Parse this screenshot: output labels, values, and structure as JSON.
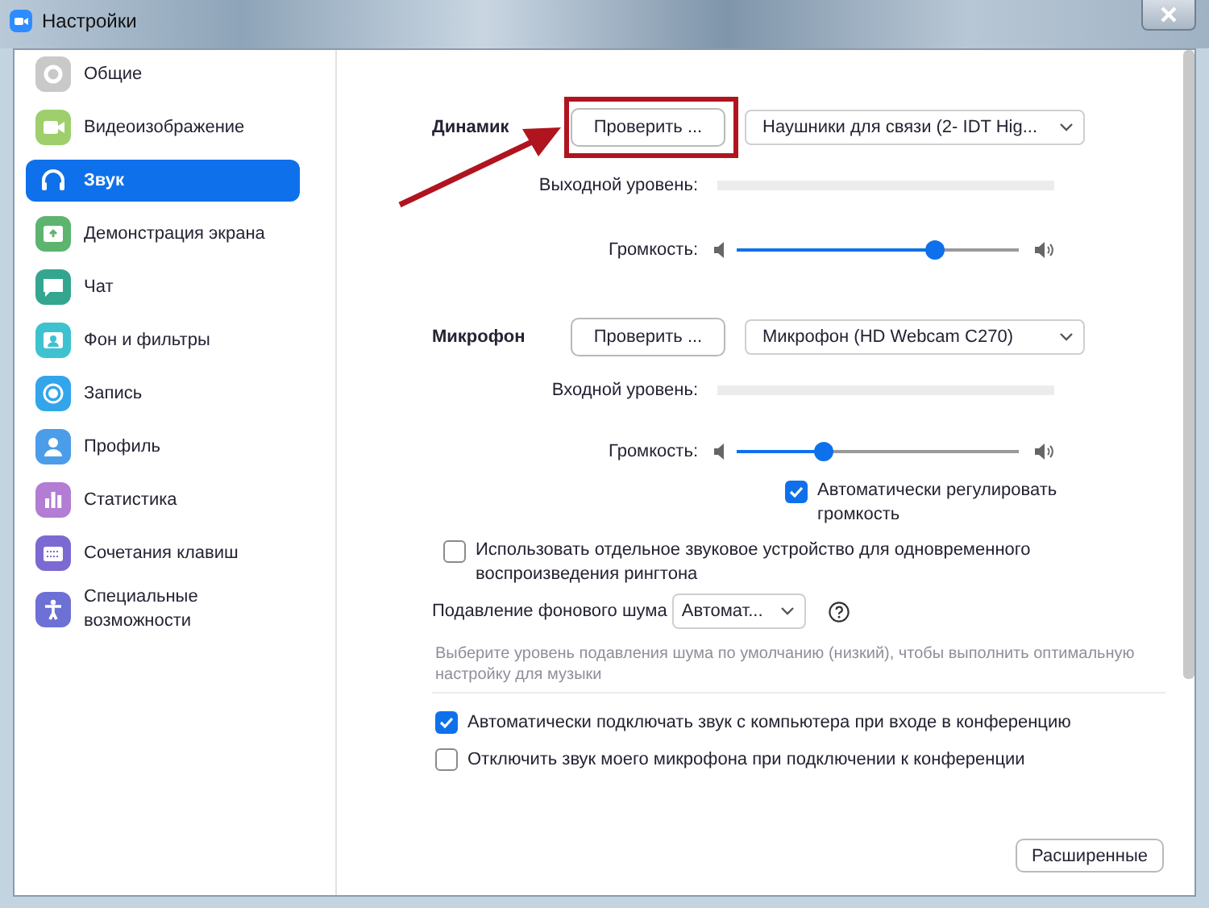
{
  "window": {
    "title": "Настройки"
  },
  "sidebar": {
    "items": [
      {
        "label": "Общие",
        "selected": false
      },
      {
        "label": "Видеоизображение",
        "selected": false
      },
      {
        "label": "Звук",
        "selected": true
      },
      {
        "label": "Демонстрация экрана",
        "selected": false
      },
      {
        "label": "Чат",
        "selected": false
      },
      {
        "label": "Фон и фильтры",
        "selected": false
      },
      {
        "label": "Запись",
        "selected": false
      },
      {
        "label": "Профиль",
        "selected": false
      },
      {
        "label": "Статистика",
        "selected": false
      },
      {
        "label": "Сочетания клавиш",
        "selected": false
      },
      {
        "label": "Специальные возможности",
        "selected": false
      }
    ]
  },
  "speaker": {
    "label": "Динамик",
    "test_button": "Проверить ...",
    "device": "Наушники для связи (2- IDT Hig...",
    "meter_label": "Выходной уровень:",
    "meter": {
      "level": 0
    },
    "volume_label": "Громкость:",
    "volume": {
      "level": 0.7
    }
  },
  "microphone": {
    "label": "Микрофон",
    "test_button": "Проверить ...",
    "device": "Микрофон (HD Webcam C270)",
    "meter_label": "Входной уровень:",
    "meter": {
      "level": 0
    },
    "volume_label": "Громкость:",
    "volume": {
      "level": 0.31
    },
    "auto_adjust": {
      "label": "Автоматически регулировать громкость",
      "checked": true
    }
  },
  "separate_device": {
    "label": "Использовать отдельное звуковое устройство для одновременного воспроизведения рингтона",
    "checked": false
  },
  "noise_suppression": {
    "label": "Подавление фонового шума",
    "value": "Автомат...",
    "hint": "Выберите уровень подавления шума по умолчанию (низкий), чтобы выполнить оптимальную настройку для музыки"
  },
  "options": [
    {
      "label": "Автоматически подключать звук с компьютера при входе в конференцию",
      "checked": true
    },
    {
      "label": "Отключить звук моего микрофона при подключении к конференции",
      "checked": false
    }
  ],
  "advanced_button": "Расширенные"
}
